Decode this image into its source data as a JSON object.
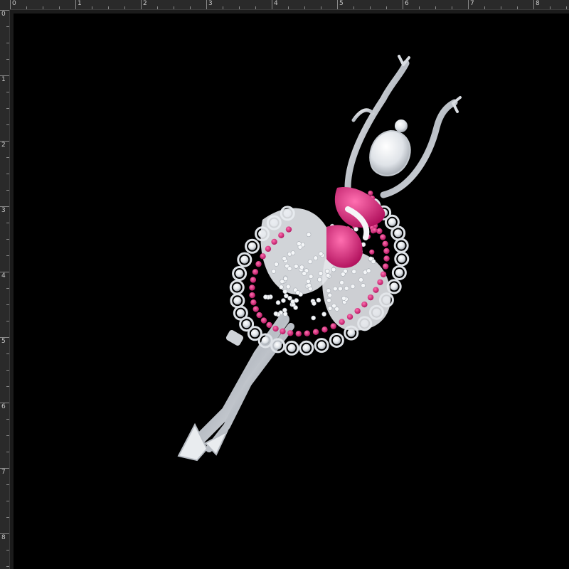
{
  "rulers": {
    "horizontal_labels": [
      "0",
      "1",
      "2",
      "3",
      "4",
      "5",
      "6",
      "7",
      "8"
    ],
    "vertical_labels": [
      "0",
      "1",
      "2",
      "3",
      "4",
      "5",
      "6",
      "7",
      "8"
    ]
  },
  "canvas": {
    "background_color": "#000000",
    "subject": "ballerina-brooch-icon",
    "colors": {
      "silver": "#d9dde2",
      "ruby_pink": "#d41e7a",
      "crystal": "#f2f4f7"
    }
  }
}
